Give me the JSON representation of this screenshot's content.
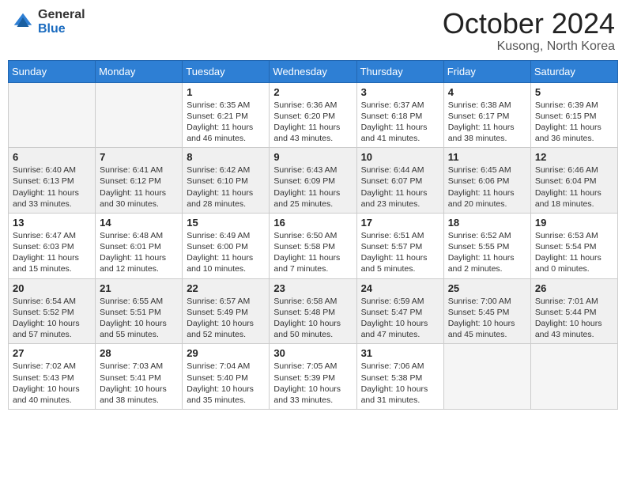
{
  "header": {
    "logo_general": "General",
    "logo_blue": "Blue",
    "title": "October 2024",
    "location": "Kusong, North Korea"
  },
  "days_of_week": [
    "Sunday",
    "Monday",
    "Tuesday",
    "Wednesday",
    "Thursday",
    "Friday",
    "Saturday"
  ],
  "weeks": [
    [
      {
        "day": "",
        "sunrise": "",
        "sunset": "",
        "daylight": ""
      },
      {
        "day": "",
        "sunrise": "",
        "sunset": "",
        "daylight": ""
      },
      {
        "day": "1",
        "sunrise": "Sunrise: 6:35 AM",
        "sunset": "Sunset: 6:21 PM",
        "daylight": "Daylight: 11 hours and 46 minutes."
      },
      {
        "day": "2",
        "sunrise": "Sunrise: 6:36 AM",
        "sunset": "Sunset: 6:20 PM",
        "daylight": "Daylight: 11 hours and 43 minutes."
      },
      {
        "day": "3",
        "sunrise": "Sunrise: 6:37 AM",
        "sunset": "Sunset: 6:18 PM",
        "daylight": "Daylight: 11 hours and 41 minutes."
      },
      {
        "day": "4",
        "sunrise": "Sunrise: 6:38 AM",
        "sunset": "Sunset: 6:17 PM",
        "daylight": "Daylight: 11 hours and 38 minutes."
      },
      {
        "day": "5",
        "sunrise": "Sunrise: 6:39 AM",
        "sunset": "Sunset: 6:15 PM",
        "daylight": "Daylight: 11 hours and 36 minutes."
      }
    ],
    [
      {
        "day": "6",
        "sunrise": "Sunrise: 6:40 AM",
        "sunset": "Sunset: 6:13 PM",
        "daylight": "Daylight: 11 hours and 33 minutes."
      },
      {
        "day": "7",
        "sunrise": "Sunrise: 6:41 AM",
        "sunset": "Sunset: 6:12 PM",
        "daylight": "Daylight: 11 hours and 30 minutes."
      },
      {
        "day": "8",
        "sunrise": "Sunrise: 6:42 AM",
        "sunset": "Sunset: 6:10 PM",
        "daylight": "Daylight: 11 hours and 28 minutes."
      },
      {
        "day": "9",
        "sunrise": "Sunrise: 6:43 AM",
        "sunset": "Sunset: 6:09 PM",
        "daylight": "Daylight: 11 hours and 25 minutes."
      },
      {
        "day": "10",
        "sunrise": "Sunrise: 6:44 AM",
        "sunset": "Sunset: 6:07 PM",
        "daylight": "Daylight: 11 hours and 23 minutes."
      },
      {
        "day": "11",
        "sunrise": "Sunrise: 6:45 AM",
        "sunset": "Sunset: 6:06 PM",
        "daylight": "Daylight: 11 hours and 20 minutes."
      },
      {
        "day": "12",
        "sunrise": "Sunrise: 6:46 AM",
        "sunset": "Sunset: 6:04 PM",
        "daylight": "Daylight: 11 hours and 18 minutes."
      }
    ],
    [
      {
        "day": "13",
        "sunrise": "Sunrise: 6:47 AM",
        "sunset": "Sunset: 6:03 PM",
        "daylight": "Daylight: 11 hours and 15 minutes."
      },
      {
        "day": "14",
        "sunrise": "Sunrise: 6:48 AM",
        "sunset": "Sunset: 6:01 PM",
        "daylight": "Daylight: 11 hours and 12 minutes."
      },
      {
        "day": "15",
        "sunrise": "Sunrise: 6:49 AM",
        "sunset": "Sunset: 6:00 PM",
        "daylight": "Daylight: 11 hours and 10 minutes."
      },
      {
        "day": "16",
        "sunrise": "Sunrise: 6:50 AM",
        "sunset": "Sunset: 5:58 PM",
        "daylight": "Daylight: 11 hours and 7 minutes."
      },
      {
        "day": "17",
        "sunrise": "Sunrise: 6:51 AM",
        "sunset": "Sunset: 5:57 PM",
        "daylight": "Daylight: 11 hours and 5 minutes."
      },
      {
        "day": "18",
        "sunrise": "Sunrise: 6:52 AM",
        "sunset": "Sunset: 5:55 PM",
        "daylight": "Daylight: 11 hours and 2 minutes."
      },
      {
        "day": "19",
        "sunrise": "Sunrise: 6:53 AM",
        "sunset": "Sunset: 5:54 PM",
        "daylight": "Daylight: 11 hours and 0 minutes."
      }
    ],
    [
      {
        "day": "20",
        "sunrise": "Sunrise: 6:54 AM",
        "sunset": "Sunset: 5:52 PM",
        "daylight": "Daylight: 10 hours and 57 minutes."
      },
      {
        "day": "21",
        "sunrise": "Sunrise: 6:55 AM",
        "sunset": "Sunset: 5:51 PM",
        "daylight": "Daylight: 10 hours and 55 minutes."
      },
      {
        "day": "22",
        "sunrise": "Sunrise: 6:57 AM",
        "sunset": "Sunset: 5:49 PM",
        "daylight": "Daylight: 10 hours and 52 minutes."
      },
      {
        "day": "23",
        "sunrise": "Sunrise: 6:58 AM",
        "sunset": "Sunset: 5:48 PM",
        "daylight": "Daylight: 10 hours and 50 minutes."
      },
      {
        "day": "24",
        "sunrise": "Sunrise: 6:59 AM",
        "sunset": "Sunset: 5:47 PM",
        "daylight": "Daylight: 10 hours and 47 minutes."
      },
      {
        "day": "25",
        "sunrise": "Sunrise: 7:00 AM",
        "sunset": "Sunset: 5:45 PM",
        "daylight": "Daylight: 10 hours and 45 minutes."
      },
      {
        "day": "26",
        "sunrise": "Sunrise: 7:01 AM",
        "sunset": "Sunset: 5:44 PM",
        "daylight": "Daylight: 10 hours and 43 minutes."
      }
    ],
    [
      {
        "day": "27",
        "sunrise": "Sunrise: 7:02 AM",
        "sunset": "Sunset: 5:43 PM",
        "daylight": "Daylight: 10 hours and 40 minutes."
      },
      {
        "day": "28",
        "sunrise": "Sunrise: 7:03 AM",
        "sunset": "Sunset: 5:41 PM",
        "daylight": "Daylight: 10 hours and 38 minutes."
      },
      {
        "day": "29",
        "sunrise": "Sunrise: 7:04 AM",
        "sunset": "Sunset: 5:40 PM",
        "daylight": "Daylight: 10 hours and 35 minutes."
      },
      {
        "day": "30",
        "sunrise": "Sunrise: 7:05 AM",
        "sunset": "Sunset: 5:39 PM",
        "daylight": "Daylight: 10 hours and 33 minutes."
      },
      {
        "day": "31",
        "sunrise": "Sunrise: 7:06 AM",
        "sunset": "Sunset: 5:38 PM",
        "daylight": "Daylight: 10 hours and 31 minutes."
      },
      {
        "day": "",
        "sunrise": "",
        "sunset": "",
        "daylight": ""
      },
      {
        "day": "",
        "sunrise": "",
        "sunset": "",
        "daylight": ""
      }
    ]
  ]
}
